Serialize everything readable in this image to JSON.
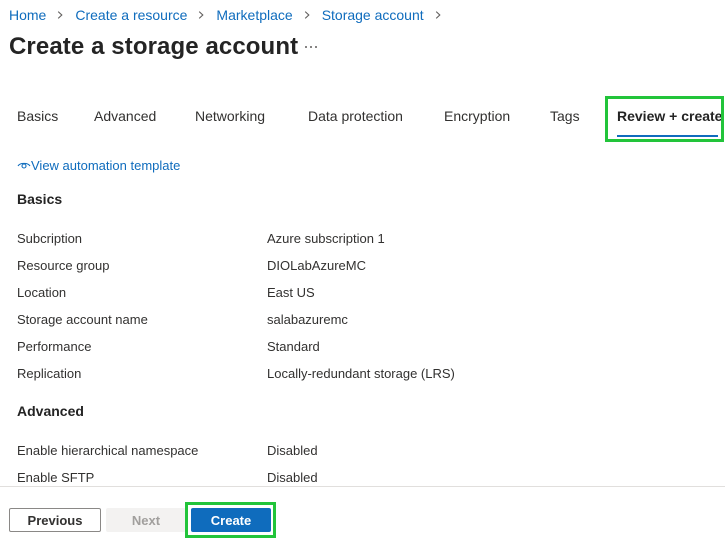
{
  "breadcrumb": {
    "items": [
      "Home",
      "Create a resource",
      "Marketplace",
      "Storage account"
    ],
    "separator_icon": "chevron-right-icon"
  },
  "page": {
    "title": "Create a storage account",
    "more_icon": "ellipsis-icon"
  },
  "tabs": {
    "items": [
      "Basics",
      "Advanced",
      "Networking",
      "Data protection",
      "Encryption",
      "Tags",
      "Review + create"
    ],
    "active": "Review + create"
  },
  "automation": {
    "label": "View automation template",
    "icon": "eye-icon"
  },
  "sections": {
    "basics": {
      "title": "Basics",
      "rows": [
        {
          "label": "Subcription",
          "value": "Azure subscription 1"
        },
        {
          "label": "Resource group",
          "value": "DIOLabAzureMC"
        },
        {
          "label": "Location",
          "value": "East US"
        },
        {
          "label": "Storage account name",
          "value": "salabazuremc"
        },
        {
          "label": "Performance",
          "value": "Standard"
        },
        {
          "label": "Replication",
          "value": "Locally-redundant storage (LRS)"
        }
      ]
    },
    "advanced": {
      "title": "Advanced",
      "rows": [
        {
          "label": "Enable hierarchical namespace",
          "value": "Disabled"
        },
        {
          "label": "Enable SFTP",
          "value": "Disabled"
        }
      ]
    }
  },
  "footer": {
    "previous_label": "Previous",
    "next_label": "Next",
    "create_label": "Create"
  },
  "colors": {
    "accent": "#0f6cbd",
    "highlight": "#22c43a",
    "text": "#323130",
    "disabled_bg": "#f3f2f1",
    "disabled_text": "#a19f9d"
  }
}
